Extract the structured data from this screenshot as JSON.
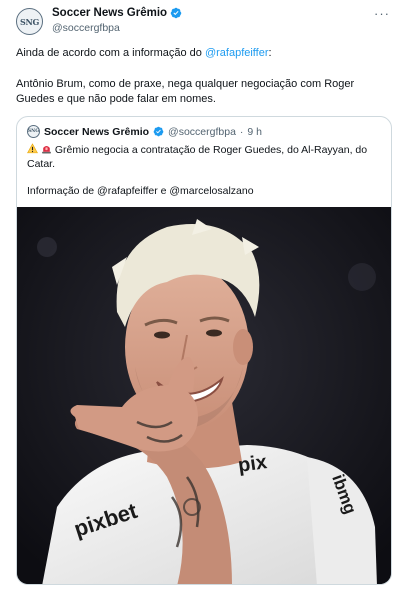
{
  "author": {
    "name": "Soccer News Grêmio",
    "handle": "@soccergfbpa",
    "avatar_monogram": "SNG",
    "verified_color": "#1d9bf0"
  },
  "menu": {
    "more_label": "···"
  },
  "tweet": {
    "line1_prefix": "Ainda de acordo com a informação do ",
    "line1_mention": "@rafapfeiffer",
    "line1_suffix": ":",
    "line2": "Antônio Brum, como de praxe, nega qualquer negociação com Roger Guedes e que não pode falar em nomes."
  },
  "quote": {
    "name": "Soccer News Grêmio",
    "handle": "@soccergfbpa",
    "separator": "·",
    "time": "9 h",
    "text": "Grêmio negocia a contratação de Roger Guedes, do Al-Rayyan, do Catar.",
    "credit": "Informação de @rafapfeiffer e @marcelosalzano",
    "emoji": [
      "warning-icon",
      "siren-icon"
    ]
  },
  "photo": {
    "shirt_text_left": "pixbet",
    "shirt_text_chest": "pix",
    "sleeve_text": "ibmg",
    "colors": {
      "background": "#14141a",
      "hair": "#ece8d8",
      "skin": "#d9a48d",
      "shirt": "#f2f2f2"
    }
  }
}
